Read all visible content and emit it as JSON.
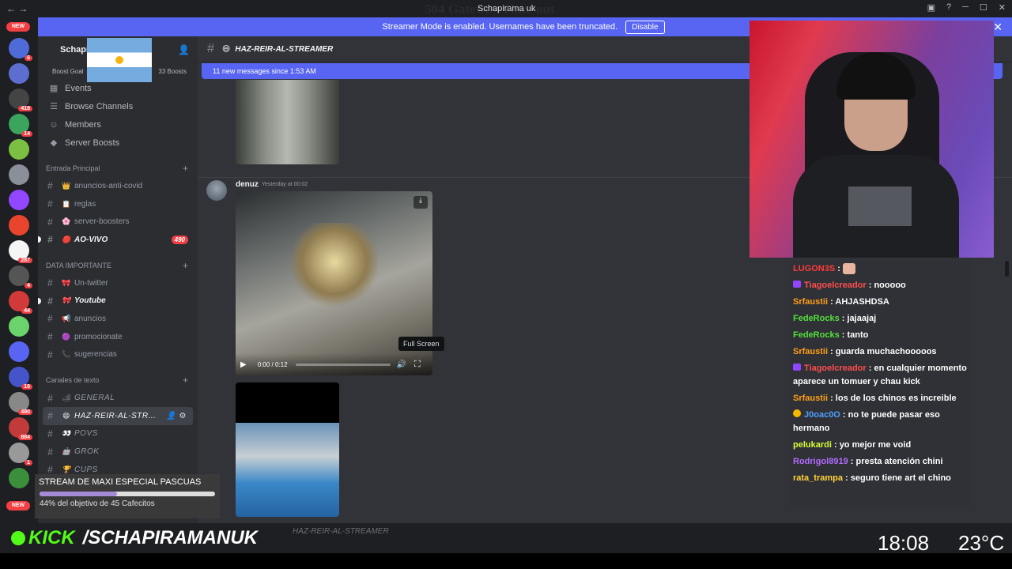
{
  "window": {
    "title": "Schapirama uk",
    "error_overlay": "504 Gateway Time-out"
  },
  "banner": {
    "text": "Streamer Mode is enabled. Usernames have been truncated.",
    "button": "Disable"
  },
  "guilds": [
    {
      "color": "#4f6bd8",
      "badge": "6"
    },
    {
      "color": "#5c6fd0",
      "badge": ""
    },
    {
      "color": "#444",
      "badge": "418"
    },
    {
      "color": "#3ba55d",
      "badge": "14"
    },
    {
      "color": "#7bc043",
      "badge": ""
    },
    {
      "color": "#8a8f99",
      "badge": ""
    },
    {
      "color": "#9146ff",
      "badge": ""
    },
    {
      "color": "#e8452c",
      "badge": ""
    },
    {
      "color": "#f5f5f5",
      "badge": "287"
    },
    {
      "color": "#555",
      "badge": "4"
    },
    {
      "color": "#d23a3a",
      "badge": "44"
    },
    {
      "color": "#6bd36b",
      "badge": ""
    },
    {
      "color": "#5865f2",
      "badge": ""
    },
    {
      "color": "#4554c8",
      "badge": "16"
    },
    {
      "color": "#888",
      "badge": "490"
    },
    {
      "color": "#c23b3b",
      "badge": "884"
    },
    {
      "color": "#999",
      "badge": "1"
    },
    {
      "color": "#3b8f3b",
      "badge": ""
    }
  ],
  "new_label": "NEW",
  "server": {
    "name": "Schapi",
    "boost_goal": "Boost Goal",
    "boosts": "33 Boosts"
  },
  "menu": [
    {
      "icon": "calendar-icon",
      "glyph": "▦",
      "label": "Events"
    },
    {
      "icon": "browse-icon",
      "glyph": "☰",
      "label": "Browse Channels"
    },
    {
      "icon": "members-icon",
      "glyph": "☺",
      "label": "Members"
    },
    {
      "icon": "boost-icon",
      "glyph": "◆",
      "label": "Server Boosts"
    }
  ],
  "categories": {
    "entrada": "Entrada Principal",
    "data": "DATA IMPORTANTE",
    "texto": "Canales de texto"
  },
  "channels_entrada": [
    {
      "emoji": "👑",
      "label": "anuncios-anti-covid"
    },
    {
      "emoji": "📋",
      "label": "reglas"
    },
    {
      "emoji": "🌸",
      "label": "server-boosters"
    },
    {
      "emoji": "🔴",
      "label": "AO-VIVO",
      "count": "490"
    }
  ],
  "channels_data": [
    {
      "emoji": "🎀",
      "label": "Un-twitter"
    },
    {
      "emoji": "🎀",
      "label": "Youtube"
    },
    {
      "emoji": "📢",
      "label": "anuncios"
    },
    {
      "emoji": "🟣",
      "label": "promocionate"
    },
    {
      "emoji": "📞",
      "label": "sugerencias"
    }
  ],
  "channels_texto": [
    {
      "emoji": "🏕",
      "label": "GENERAL"
    },
    {
      "emoji": "😄",
      "label": "HAZ-REIR-AL-STR..."
    },
    {
      "emoji": "👀",
      "label": "POVS"
    },
    {
      "emoji": "🤖",
      "label": "GROK"
    },
    {
      "emoji": "🏆",
      "label": "CUPS"
    }
  ],
  "main": {
    "channel": "HAZ-REIR-AL-STREAMER",
    "new_messages": "11 new messages since 1:53 AM",
    "author": "denuz",
    "timestamp": "Yesterday at 00:02",
    "video_time": "0:00 / 0:12",
    "tooltip": "Full Screen",
    "input_placeholder": "HAZ-REIR-AL-STREAMER"
  },
  "chat": [
    {
      "user": "LUGON3S",
      "color": "#ff3b3b",
      "badge": "",
      "msg": "",
      "emote": true
    },
    {
      "user": "Tiagoelcreador",
      "color": "#ff4d4d",
      "badge": "sub",
      "msg": "nooooo"
    },
    {
      "user": "Srfaustii",
      "color": "#ff9f1a",
      "badge": "",
      "msg": "AHJASHDSA"
    },
    {
      "user": "FedeRocks",
      "color": "#53e03b",
      "badge": "",
      "msg": "jajaajaj"
    },
    {
      "user": "FedeRocks",
      "color": "#53e03b",
      "badge": "",
      "msg": "tanto"
    },
    {
      "user": "Srfaustii",
      "color": "#ff9f1a",
      "badge": "",
      "msg": "guarda muchachooooos"
    },
    {
      "user": "Tiagoelcreador",
      "color": "#ff4d4d",
      "badge": "sub",
      "msg": "en cualquier momento aparece un tomuer y chau kick"
    },
    {
      "user": "Srfaustii",
      "color": "#ff9f1a",
      "badge": "",
      "msg": "los de los chinos es increible"
    },
    {
      "user": "J0oac0O",
      "color": "#4ea0ff",
      "badge": "vip",
      "msg": "no te puede pasar eso hermano"
    },
    {
      "user": "pelukardi",
      "color": "#d7ff3a",
      "badge": "",
      "msg": "yo mejor me void"
    },
    {
      "user": "Rodrigol8919",
      "color": "#b36bff",
      "badge": "",
      "msg": "presta atención chini"
    },
    {
      "user": "rata_trampa",
      "color": "#ffd23a",
      "badge": "",
      "msg": "seguro tiene art el chino"
    }
  ],
  "goal": {
    "title": "STREAM DE MAXI ESPECIAL PASCUAS",
    "progress": 0.44,
    "subtitle": "44% del objetivo de 45 Cafecitos"
  },
  "kick": {
    "logo": "KICK",
    "handle": "/SCHAPIRAMANUK"
  },
  "clock": "18:08",
  "temperature": "23°C"
}
